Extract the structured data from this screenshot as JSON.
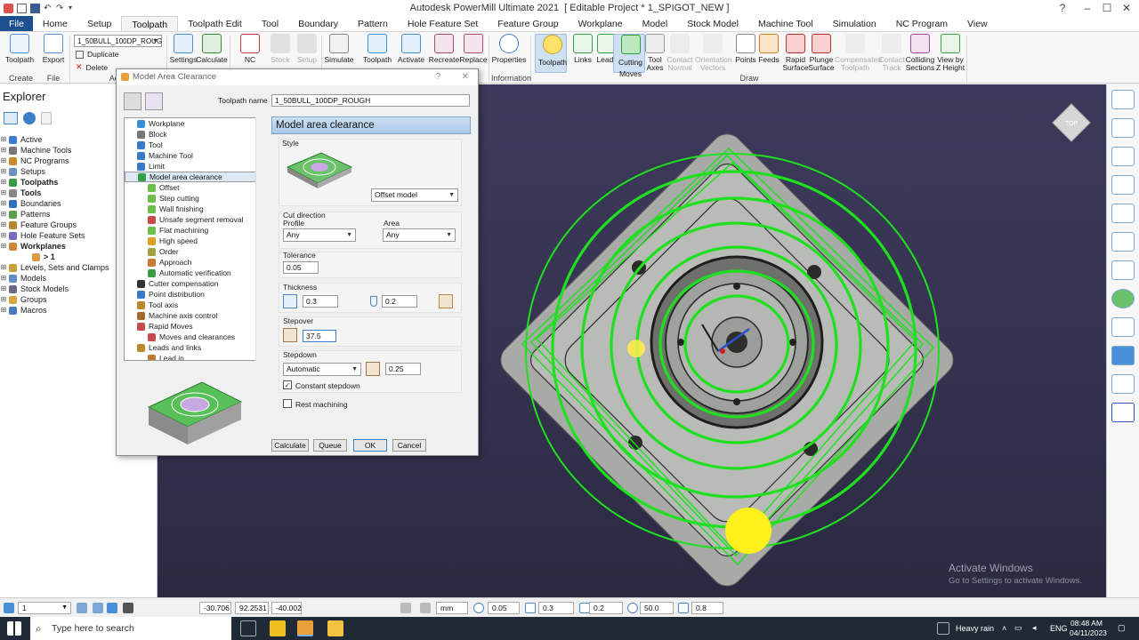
{
  "window": {
    "title_app": "Autodesk PowerMill Ultimate 2021",
    "title_project": "[ Editable Project * 1_SPIGOT_NEW ]",
    "help": "?",
    "min": "–",
    "max": "☐",
    "close": "✕"
  },
  "menu": [
    "File",
    "Home",
    "Setup",
    "Toolpath",
    "Toolpath Edit",
    "Tool",
    "Boundary",
    "Pattern",
    "Hole Feature Set",
    "Feature Group",
    "Workplane",
    "Model",
    "Stock Model",
    "Machine Tool",
    "Simulation",
    "NC Program",
    "View"
  ],
  "ribbon": {
    "create_label": "Toolpath",
    "export_label": "Export",
    "toolpath_select": "1_50BULL_100DP_ROUG",
    "duplicate": "Duplicate",
    "delete": "Delete",
    "settings": "Settings",
    "calculate": "Calculate",
    "nc": "NC",
    "stock": "Stock",
    "setup": "Setup",
    "simulate": "Simulate",
    "toolpath_stat": "Toolpath",
    "activate": "Activate",
    "recreate": "Recreate",
    "replace": "Replace",
    "properties": "Properties",
    "draw_toolpath": "Toolpath",
    "links": "Links",
    "leads": "Leads",
    "cutting_moves": "Cutting Moves",
    "tool_axes": "Tool Axes",
    "contact_normal": "Contact Normal",
    "orientation_vectors": "Orientation Vectors",
    "points": "Points",
    "feeds": "Feeds",
    "rapid_surface": "Rapid Surface",
    "plunge_surface": "Plunge Surface",
    "compensated": "Compensated Toolpath",
    "contact_track": "Contact Track",
    "colliding": "Colliding Sections",
    "view_by_z": "View by Z Height",
    "groups": {
      "create": "Create",
      "file": "File",
      "information": "Information",
      "draw": "Draw",
      "ac": "Ac"
    }
  },
  "explorer": {
    "title": "Explorer",
    "items": [
      {
        "label": "Active",
        "bold": false,
        "color": "#3a7bd5"
      },
      {
        "label": "Machine Tools",
        "bold": false,
        "color": "#777777"
      },
      {
        "label": "NC Programs",
        "bold": false,
        "color": "#c98a2c"
      },
      {
        "label": "Setups",
        "bold": false,
        "color": "#6b8fbf"
      },
      {
        "label": "Toolpaths",
        "bold": true,
        "color": "#3a9a46"
      },
      {
        "label": "Tools",
        "bold": true,
        "color": "#888888"
      },
      {
        "label": "Boundaries",
        "bold": false,
        "color": "#2f6fc0"
      },
      {
        "label": "Patterns",
        "bold": false,
        "color": "#5aa04a"
      },
      {
        "label": "Feature Groups",
        "bold": false,
        "color": "#b8852a"
      },
      {
        "label": "Hole Feature Sets",
        "bold": false,
        "color": "#7a6ac0"
      },
      {
        "label": "Workplanes",
        "bold": true,
        "color": "#cc8833"
      },
      {
        "label": "> 1",
        "bold": true,
        "color": "#dd9944",
        "indent": true
      },
      {
        "label": "Levels, Sets and Clamps",
        "bold": false,
        "color": "#c9a236"
      },
      {
        "label": "Models",
        "bold": false,
        "color": "#5f8fc8"
      },
      {
        "label": "Stock Models",
        "bold": false,
        "color": "#6a6a8a"
      },
      {
        "label": "Groups",
        "bold": false,
        "color": "#d3a640"
      },
      {
        "label": "Macros",
        "bold": false,
        "color": "#4a7abf"
      }
    ]
  },
  "dialog": {
    "title": "Model Area Clearance",
    "help": "?",
    "close": "✕",
    "toolpath_name_label": "Toolpath name",
    "toolpath_name": "1_50BULL_100DP_ROUGH",
    "tree": [
      {
        "label": "Workplane",
        "level": 1
      },
      {
        "label": "Block",
        "level": 1
      },
      {
        "label": "Tool",
        "level": 1
      },
      {
        "label": "Machine Tool",
        "level": 1
      },
      {
        "label": "Limit",
        "level": 1
      },
      {
        "label": "Model area clearance",
        "level": 1,
        "selected": true
      },
      {
        "label": "Offset",
        "level": 2
      },
      {
        "label": "Step cutting",
        "level": 2
      },
      {
        "label": "Wall finishing",
        "level": 2
      },
      {
        "label": "Unsafe segment removal",
        "level": 2
      },
      {
        "label": "Flat machining",
        "level": 2
      },
      {
        "label": "High speed",
        "level": 2
      },
      {
        "label": "Order",
        "level": 2
      },
      {
        "label": "Approach",
        "level": 2
      },
      {
        "label": "Automatic verification",
        "level": 2
      },
      {
        "label": "Cutter compensation",
        "level": 1
      },
      {
        "label": "Point distribution",
        "level": 1
      },
      {
        "label": "Tool axis",
        "level": 1
      },
      {
        "label": "Machine axis control",
        "level": 1
      },
      {
        "label": "Rapid Moves",
        "level": 1
      },
      {
        "label": "Moves and clearances",
        "level": 2
      },
      {
        "label": "Leads and links",
        "level": 1
      },
      {
        "label": "Lead in",
        "level": 2
      }
    ],
    "page_title": "Model area clearance",
    "style_label": "Style",
    "style_value": "Offset model",
    "cut_direction_label": "Cut direction",
    "profile_label": "Profile",
    "profile_value": "Any",
    "area_label": "Area",
    "area_value": "Any",
    "tolerance_label": "Tolerance",
    "tolerance": "0.05",
    "thickness_label": "Thickness",
    "thickness_radial": "0.3",
    "thickness_axial": "0.2",
    "stepover_label": "Stepover",
    "stepover": "37.5",
    "stepdown_label": "Stepdown",
    "stepdown_mode": "Automatic",
    "stepdown": "0.25",
    "constant_stepdown": "Constant stepdown",
    "rest_machining": "Rest machining",
    "buttons": {
      "calculate": "Calculate",
      "queue": "Queue",
      "ok": "OK",
      "cancel": "Cancel"
    }
  },
  "viewport": {
    "view_cube": "TOP",
    "watermark_title": "Activate Windows",
    "watermark_sub": "Go to Settings to activate Windows."
  },
  "status": {
    "workplane": "1",
    "x": "-30.706",
    "y": "92.2531",
    "z": "-40.002",
    "units": "mm",
    "tolerance": "0.05",
    "thickness": "0.3",
    "axial": "0.2",
    "diameter": "50.0",
    "angle": "0.8"
  },
  "taskbar": {
    "search_placeholder": "Type here to search",
    "weather": "Heavy rain",
    "lang": "ENG",
    "time": "08:48 AM",
    "date": "04/11/2023"
  }
}
